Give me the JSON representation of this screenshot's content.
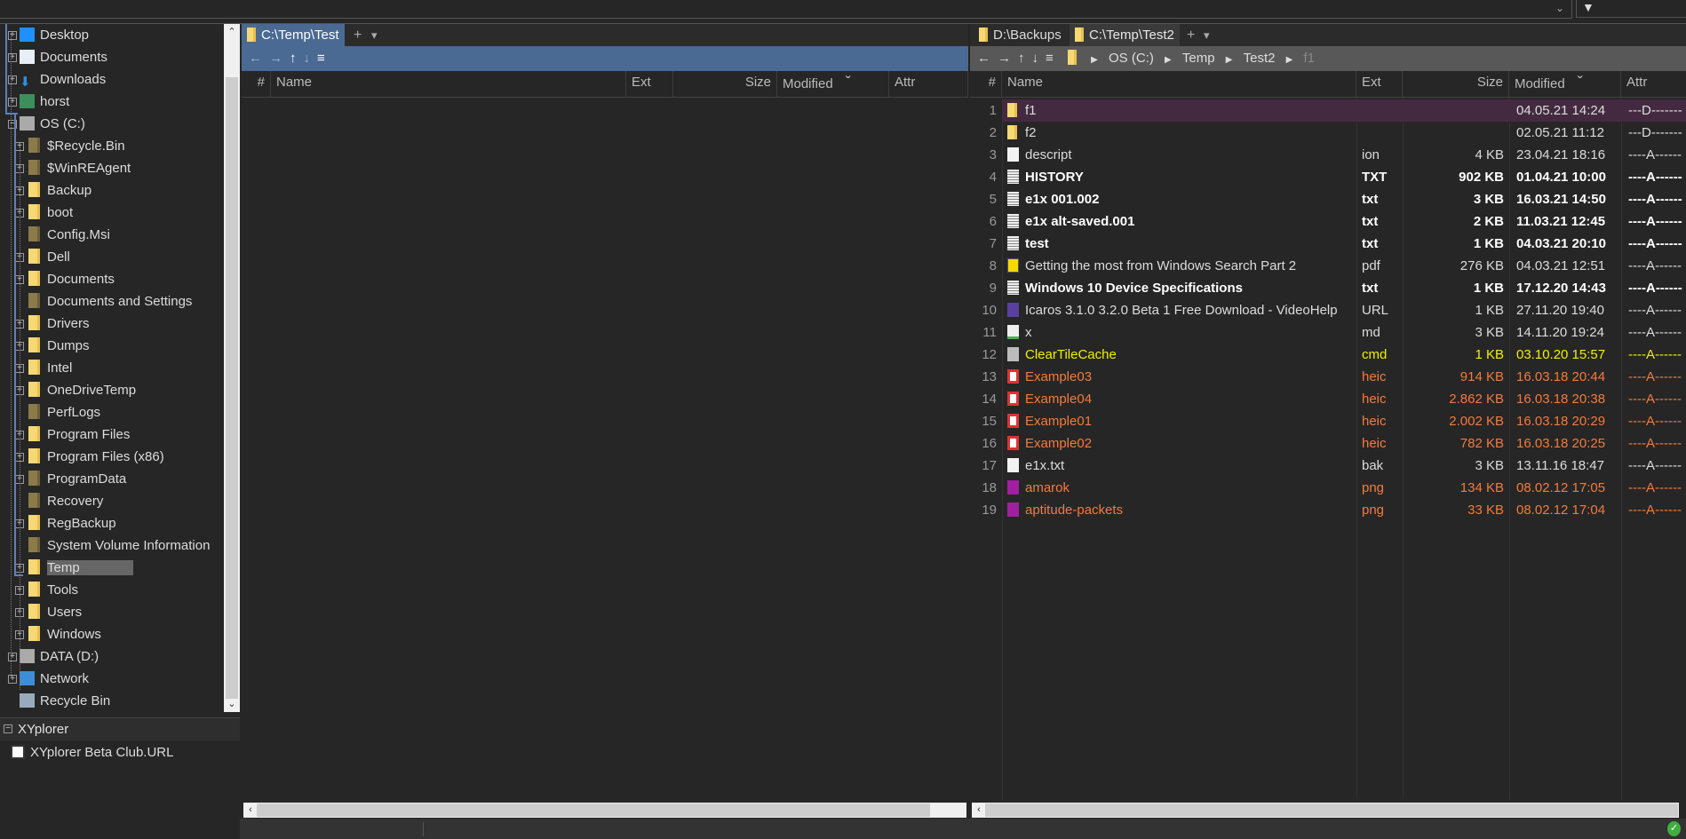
{
  "colors": {
    "accent": "#4a6a93",
    "selected_row": "#442a40",
    "cmd": "#f0f000",
    "heic_png": "#f47a3c",
    "folder": "#f6d874"
  },
  "tree": {
    "items": [
      {
        "label": "Desktop",
        "level": 0,
        "icon": "desktop-icon",
        "exp": "+"
      },
      {
        "label": "Documents",
        "level": 0,
        "icon": "documents-icon",
        "exp": "+"
      },
      {
        "label": "Downloads",
        "level": 0,
        "icon": "download-arrow-icon",
        "exp": "+"
      },
      {
        "label": "horst",
        "level": 0,
        "icon": "user-icon",
        "exp": "+"
      },
      {
        "label": "OS (C:)",
        "level": 0,
        "icon": "drive-icon",
        "exp": "-"
      },
      {
        "label": "$Recycle.Bin",
        "level": 1,
        "icon": "hidden-folder-icon",
        "exp": "+"
      },
      {
        "label": "$WinREAgent",
        "level": 1,
        "icon": "hidden-folder-icon",
        "exp": "+"
      },
      {
        "label": "Backup",
        "level": 1,
        "icon": "folder-icon",
        "exp": "+"
      },
      {
        "label": "boot",
        "level": 1,
        "icon": "folder-icon",
        "exp": "+"
      },
      {
        "label": "Config.Msi",
        "level": 1,
        "icon": "hidden-folder-icon",
        "exp": ""
      },
      {
        "label": "Dell",
        "level": 1,
        "icon": "folder-icon",
        "exp": "+"
      },
      {
        "label": "Documents",
        "level": 1,
        "icon": "folder-icon",
        "exp": "+"
      },
      {
        "label": "Documents and Settings",
        "level": 1,
        "icon": "hidden-folder-icon",
        "exp": ""
      },
      {
        "label": "Drivers",
        "level": 1,
        "icon": "folder-icon",
        "exp": "+"
      },
      {
        "label": "Dumps",
        "level": 1,
        "icon": "folder-icon",
        "exp": "+"
      },
      {
        "label": "Intel",
        "level": 1,
        "icon": "folder-icon",
        "exp": "+"
      },
      {
        "label": "OneDriveTemp",
        "level": 1,
        "icon": "folder-icon",
        "exp": "+"
      },
      {
        "label": "PerfLogs",
        "level": 1,
        "icon": "hidden-folder-icon",
        "exp": ""
      },
      {
        "label": "Program Files",
        "level": 1,
        "icon": "folder-icon",
        "exp": "+"
      },
      {
        "label": "Program Files (x86)",
        "level": 1,
        "icon": "folder-icon",
        "exp": "+"
      },
      {
        "label": "ProgramData",
        "level": 1,
        "icon": "hidden-folder-icon",
        "exp": "+"
      },
      {
        "label": "Recovery",
        "level": 1,
        "icon": "hidden-folder-icon",
        "exp": ""
      },
      {
        "label": "RegBackup",
        "level": 1,
        "icon": "folder-icon",
        "exp": "+"
      },
      {
        "label": "System Volume Information",
        "level": 1,
        "icon": "hidden-folder-icon",
        "exp": ""
      },
      {
        "label": "Temp",
        "level": 1,
        "icon": "folder-icon",
        "exp": "+",
        "selected": true
      },
      {
        "label": "Tools",
        "level": 1,
        "icon": "folder-icon",
        "exp": "+"
      },
      {
        "label": "Users",
        "level": 1,
        "icon": "folder-icon",
        "exp": "+"
      },
      {
        "label": "Windows",
        "level": 1,
        "icon": "folder-icon",
        "exp": "+"
      },
      {
        "label": "DATA (D:)",
        "level": 0,
        "icon": "drive-icon",
        "exp": "+"
      },
      {
        "label": "Network",
        "level": 0,
        "icon": "network-icon",
        "exp": "+"
      },
      {
        "label": "Recycle Bin",
        "level": 0,
        "icon": "recycle-bin-icon",
        "exp": ""
      }
    ]
  },
  "catalog": {
    "title": "XYplorer",
    "items": [
      {
        "label": "XYplorer Beta Club.URL"
      }
    ]
  },
  "left_pane": {
    "tabs": [
      {
        "label": "C:\\Temp\\Test"
      }
    ],
    "columns": [
      "#",
      "Name",
      "Ext",
      "Size",
      "Modified",
      "Attr"
    ]
  },
  "right_pane": {
    "tabs": [
      {
        "label": "D:\\Backups"
      },
      {
        "label": "C:\\Temp\\Test2"
      }
    ],
    "breadcrumb": [
      "OS (C:)",
      "Temp",
      "Test2",
      "f1"
    ],
    "columns": [
      "#",
      "Name",
      "Ext",
      "Size",
      "Modified",
      "Attr"
    ],
    "rows": [
      {
        "n": "1",
        "name": "f1",
        "ext": "",
        "size": "",
        "mod": "04.05.21 14:24",
        "attr": "---D-------",
        "type": "folder",
        "style": "normal",
        "selected": true
      },
      {
        "n": "2",
        "name": "f2",
        "ext": "",
        "size": "",
        "mod": "02.05.21 11:12",
        "attr": "---D-------",
        "type": "folder",
        "style": "normal"
      },
      {
        "n": "3",
        "name": "descript",
        "ext": "ion",
        "size": "4 KB",
        "mod": "23.04.21 18:16",
        "attr": "----A------",
        "type": "file",
        "style": "normal"
      },
      {
        "n": "4",
        "name": "HISTORY",
        "ext": "TXT",
        "size": "902 KB",
        "mod": "01.04.21 10:00",
        "attr": "----A------",
        "type": "text",
        "style": "bold"
      },
      {
        "n": "5",
        "name": "e1x 001.002",
        "ext": "txt",
        "size": "3 KB",
        "mod": "16.03.21 14:50",
        "attr": "----A------",
        "type": "text",
        "style": "bold"
      },
      {
        "n": "6",
        "name": "e1x alt-saved.001",
        "ext": "txt",
        "size": "2 KB",
        "mod": "11.03.21 12:45",
        "attr": "----A------",
        "type": "text",
        "style": "bold"
      },
      {
        "n": "7",
        "name": "test",
        "ext": "txt",
        "size": "1 KB",
        "mod": "04.03.21 20:10",
        "attr": "----A------",
        "type": "text",
        "style": "bold"
      },
      {
        "n": "8",
        "name": "Getting the most from Windows Search Part 2",
        "ext": "pdf",
        "size": "276 KB",
        "mod": "04.03.21 12:51",
        "attr": "----A------",
        "type": "pdf",
        "style": "normal"
      },
      {
        "n": "9",
        "name": "Windows 10 Device Specifications",
        "ext": "txt",
        "size": "1 KB",
        "mod": "17.12.20 14:43",
        "attr": "----A------",
        "type": "text",
        "style": "bold"
      },
      {
        "n": "10",
        "name": "Icaros 3.1.0 3.2.0 Beta 1 Free Download - VideoHelp",
        "ext": "URL",
        "size": "1 KB",
        "mod": "27.11.20 19:40",
        "attr": "----A------",
        "type": "url",
        "style": "normal"
      },
      {
        "n": "11",
        "name": "x",
        "ext": "md",
        "size": "3 KB",
        "mod": "14.11.20 19:24",
        "attr": "----A------",
        "type": "md",
        "style": "normal"
      },
      {
        "n": "12",
        "name": "ClearTileCache",
        "ext": "cmd",
        "size": "1 KB",
        "mod": "03.10.20 15:57",
        "attr": "----A------",
        "type": "cmd",
        "style": "cmd"
      },
      {
        "n": "13",
        "name": "Example03",
        "ext": "heic",
        "size": "914 KB",
        "mod": "16.03.18 20:44",
        "attr": "----A------",
        "type": "heic",
        "style": "image"
      },
      {
        "n": "14",
        "name": "Example04",
        "ext": "heic",
        "size": "2.862 KB",
        "mod": "16.03.18 20:38",
        "attr": "----A------",
        "type": "heic",
        "style": "image"
      },
      {
        "n": "15",
        "name": "Example01",
        "ext": "heic",
        "size": "2.002 KB",
        "mod": "16.03.18 20:29",
        "attr": "----A------",
        "type": "heic",
        "style": "image"
      },
      {
        "n": "16",
        "name": "Example02",
        "ext": "heic",
        "size": "782 KB",
        "mod": "16.03.18 20:25",
        "attr": "----A------",
        "type": "heic",
        "style": "image"
      },
      {
        "n": "17",
        "name": "e1x.txt",
        "ext": "bak",
        "size": "3 KB",
        "mod": "13.11.16 18:47",
        "attr": "----A------",
        "type": "file",
        "style": "normal"
      },
      {
        "n": "18",
        "name": "amarok",
        "ext": "png",
        "size": "134 KB",
        "mod": "08.02.12 17:05",
        "attr": "----A------",
        "type": "png",
        "style": "image"
      },
      {
        "n": "19",
        "name": "aptitude-packets",
        "ext": "png",
        "size": "33 KB",
        "mod": "08.02.12 17:04",
        "attr": "----A------",
        "type": "png",
        "style": "image"
      }
    ]
  },
  "icons": {
    "back": "←",
    "forward": "→",
    "up": "↑",
    "down": "↓",
    "menu": "≡",
    "sort": "ˇ",
    "plus": "+",
    "dropdown": "▾"
  }
}
